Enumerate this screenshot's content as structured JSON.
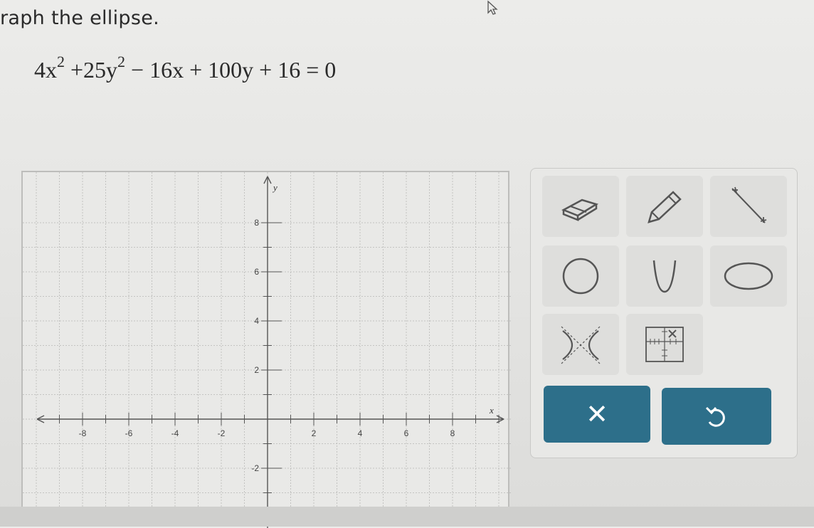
{
  "instruction": "raph the ellipse.",
  "equation": {
    "t1": "4x",
    "e1": "2",
    "t2": "+25y",
    "e2": "2",
    "t3": "− 16x + 100y + 16 = 0"
  },
  "graph": {
    "x_axis_label": "x",
    "y_axis_label": "y",
    "x_ticks": [
      {
        "label": "-8",
        "value": -8
      },
      {
        "label": "-6",
        "value": -6
      },
      {
        "label": "-4",
        "value": -4
      },
      {
        "label": "-2",
        "value": -2
      },
      {
        "label": "2",
        "value": 2
      },
      {
        "label": "4",
        "value": 4
      },
      {
        "label": "6",
        "value": 6
      },
      {
        "label": "8",
        "value": 8
      }
    ],
    "y_ticks": [
      {
        "label": "8",
        "value": 8
      },
      {
        "label": "6",
        "value": 6
      },
      {
        "label": "4",
        "value": 4
      },
      {
        "label": "2",
        "value": 2
      },
      {
        "label": "-2",
        "value": -2
      },
      {
        "label": "-4",
        "value": -4
      }
    ]
  },
  "tools": [
    {
      "name": "eraser-tool",
      "icon": "eraser-icon"
    },
    {
      "name": "pencil-tool",
      "icon": "pencil-icon"
    },
    {
      "name": "line-tool",
      "icon": "line-segment-icon"
    },
    {
      "name": "circle-tool",
      "icon": "circle-icon"
    },
    {
      "name": "parabola-tool",
      "icon": "parabola-icon"
    },
    {
      "name": "ellipse-tool",
      "icon": "ellipse-icon"
    },
    {
      "name": "hyperbola-tool",
      "icon": "hyperbola-icon"
    },
    {
      "name": "grid-tool",
      "icon": "grid-icon"
    }
  ],
  "actions": {
    "clear_label": "✕",
    "undo_icon": "undo-icon"
  },
  "colors": {
    "action_button": "#2d6f8a",
    "tool_button": "#dededc",
    "grid_line": "#b8b8b6"
  }
}
